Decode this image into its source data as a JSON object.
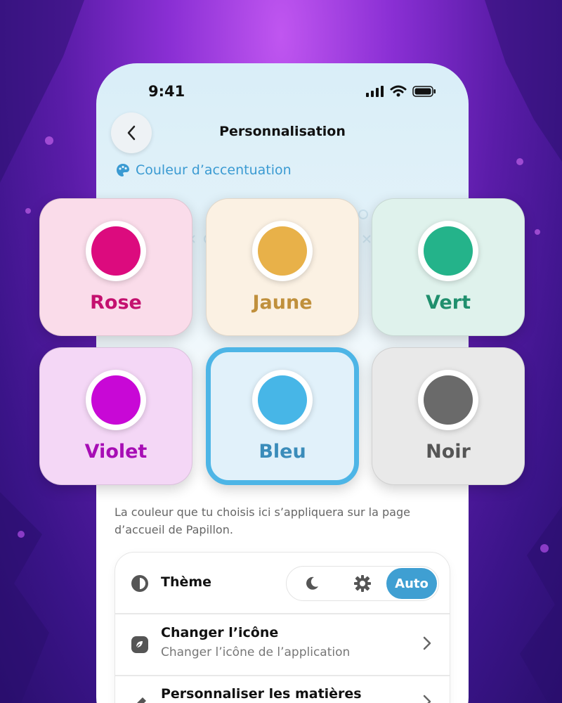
{
  "status_bar": {
    "time": "9:41"
  },
  "nav": {
    "title": "Personnalisation",
    "back_icon": "chevron-left-icon"
  },
  "accent_section": {
    "label": "Couleur d’accentuation",
    "icon": "palette-icon"
  },
  "colors": [
    {
      "label": "Rose",
      "swatch": "#dc0b7e",
      "tile_bg": "#fadcea",
      "text_color": "#c4106f",
      "selected": false
    },
    {
      "label": "Jaune",
      "swatch": "#e8b149",
      "tile_bg": "#fbf1e3",
      "text_color": "#c0903c",
      "selected": false
    },
    {
      "label": "Vert",
      "swatch": "#24b38a",
      "tile_bg": "#dff2ec",
      "text_color": "#1f8f6d",
      "selected": false
    },
    {
      "label": "Violet",
      "swatch": "#c808d6",
      "tile_bg": "#f4d7f6",
      "text_color": "#a70db5",
      "selected": false
    },
    {
      "label": "Bleu",
      "swatch": "#47b6e7",
      "tile_bg": "#e1f1fa",
      "text_color": "#3a8cba",
      "selected": true
    },
    {
      "label": "Noir",
      "swatch": "#6a6a6a",
      "tile_bg": "#e9e9e9",
      "text_color": "#555555",
      "selected": false
    }
  ],
  "description": "La couleur que tu choisis ici s’appliquera sur la page d’accueil de Papillon.",
  "settings": {
    "theme": {
      "label": "Thème",
      "icon": "contrast-icon",
      "options": [
        "moon-icon",
        "sun-gear-icon",
        "Auto"
      ],
      "selected": "Auto"
    },
    "change_icon": {
      "title": "Changer l’icône",
      "subtitle": "Changer l’icône de l’application",
      "icon": "app-icon"
    },
    "subjects": {
      "title": "Personnaliser les matières",
      "icon": "pencil-icon"
    }
  },
  "accent_color": "#3f9fd2"
}
